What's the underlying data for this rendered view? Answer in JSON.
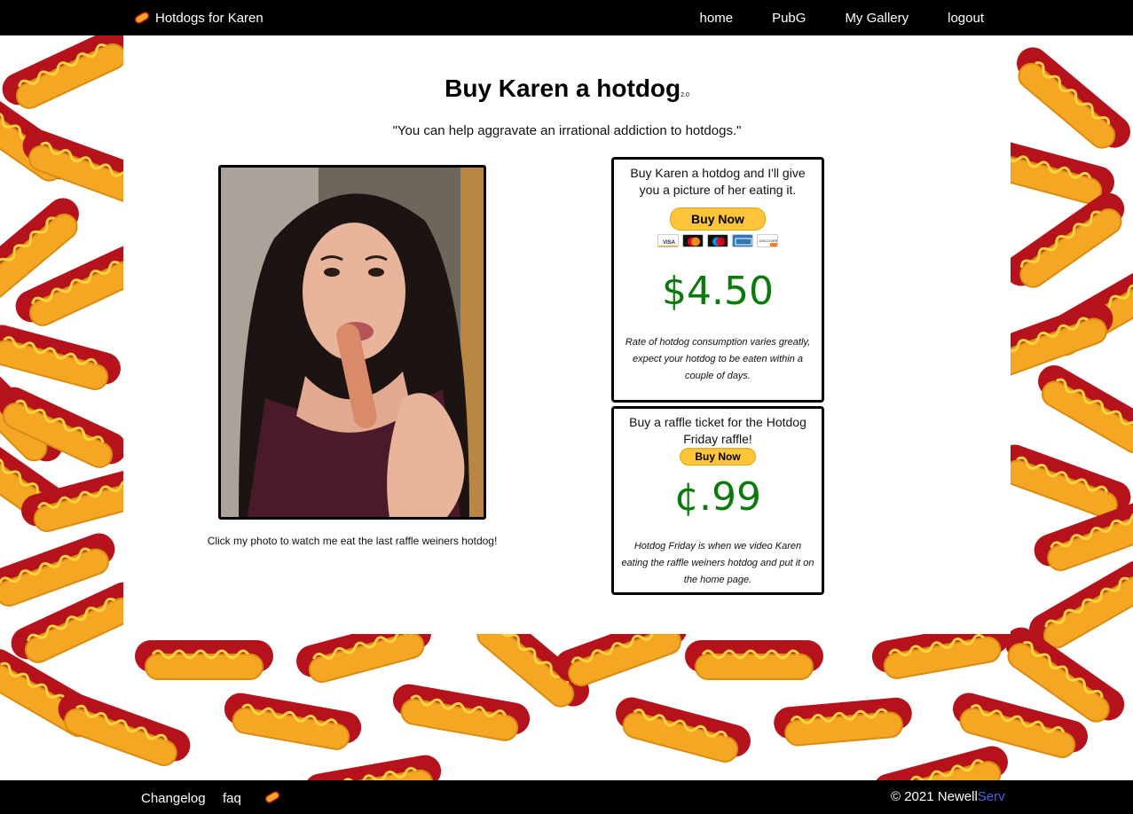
{
  "nav": {
    "brand_label": "Hotdogs for Karen",
    "links": [
      "home",
      "PubG",
      "My Gallery",
      "logout"
    ]
  },
  "page": {
    "title": "Buy Karen a hotdog",
    "version": "2.0",
    "subtitle": "\"You can help aggravate an irrational addiction to hotdogs.\""
  },
  "photo": {
    "caption": "Click my photo to watch me eat the last raffle weiners hotdog!"
  },
  "hotdog_box": {
    "text": "Buy Karen a hotdog and I'll give you a picture of her eating it.",
    "button_label": "Buy Now",
    "cards": [
      "VISA",
      "Mastercard",
      "Maestro",
      "American Express",
      "DISCOVER"
    ],
    "price": "$4.50",
    "note": "Rate of hotdog consumption varies greatly, expect your hotdog to be eaten within a couple of days."
  },
  "raffle_box": {
    "text": "Buy a raffle ticket for the Hotdog Friday raffle!",
    "button_label": "Buy Now",
    "price": "¢.99",
    "note": "Hotdog Friday is when we video Karen eating the raffle weiners hotdog and put it on the home page."
  },
  "footer": {
    "links": [
      "Changelog",
      "faq"
    ],
    "copyright": "© 2021 Newell",
    "copyright_accent": "Serv"
  },
  "colors": {
    "nav_bg": "#000000",
    "price_green": "#0a7a0a",
    "paypal_yellow": "#ffc439",
    "bun": "#f5a623",
    "sausage": "#c0161c",
    "mustard": "#ffd23f"
  },
  "icons": {
    "brand": "hotdog-icon",
    "footer": "hotdog-icon",
    "background": "hotdog-pattern"
  }
}
